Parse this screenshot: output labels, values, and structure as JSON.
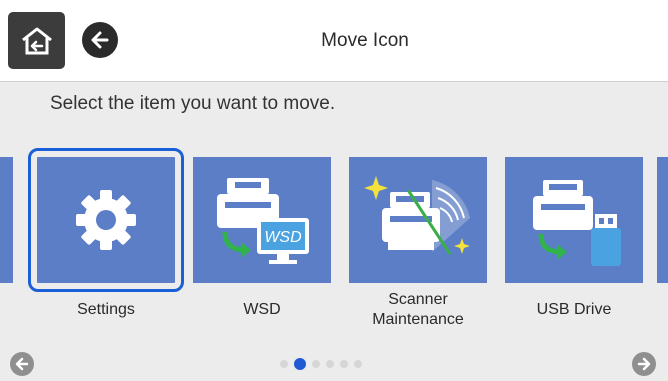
{
  "header": {
    "title": "Move Icon",
    "home_icon": "home-icon",
    "back_icon": "back-arrow-icon"
  },
  "instruction": "Select the item you want to move.",
  "tiles": [
    {
      "label": "Settings",
      "icon": "gear-icon",
      "selected": true
    },
    {
      "label": "WSD",
      "icon": "wsd-icon",
      "selected": false
    },
    {
      "label_line1": "Scanner",
      "label_line2": "Maintenance",
      "icon": "scanner-maintenance-icon",
      "selected": false
    },
    {
      "label": "USB Drive",
      "icon": "usb-drive-icon",
      "selected": false
    }
  ],
  "pagination": {
    "total_pages": 6,
    "current_page": 2,
    "prev_icon": "prev-page-icon",
    "next_icon": "next-page-icon"
  },
  "colors": {
    "tile": "#5b7ec6",
    "selection": "#1a5fd6",
    "active_dot": "#2159d4",
    "header_bg": "#ffffff",
    "page_bg": "#ececec"
  }
}
